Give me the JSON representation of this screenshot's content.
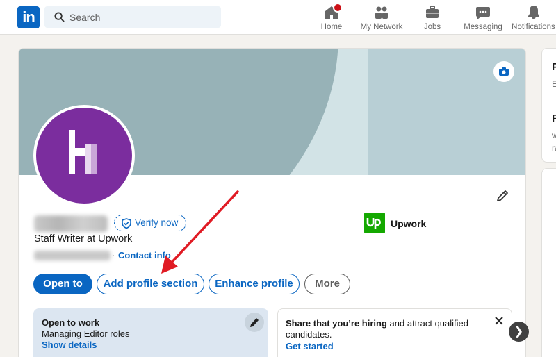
{
  "nav": {
    "logo_text": "in",
    "search_placeholder": "Search",
    "items": [
      {
        "label": "Home",
        "icon": "home-icon"
      },
      {
        "label": "My Network",
        "icon": "people-icon"
      },
      {
        "label": "Jobs",
        "icon": "briefcase-icon"
      },
      {
        "label": "Messaging",
        "icon": "chat-icon"
      },
      {
        "label": "Notifications",
        "icon": "bell-icon"
      }
    ]
  },
  "profile": {
    "verify_label": "Verify now",
    "headline": "Staff Writer at Upwork",
    "location_separator": "·",
    "contact_label": "Contact info",
    "company": {
      "name": "Upwork",
      "logo_text": "up",
      "color": "#14a800"
    },
    "buttons": {
      "open_to": "Open to",
      "add_section": "Add profile section",
      "enhance": "Enhance profile",
      "more": "More"
    }
  },
  "open_to_work": {
    "title": "Open to work",
    "roles": "Managing Editor roles",
    "link": "Show details"
  },
  "hiring": {
    "bold": "Share that you’re hiring",
    "rest": " and attract qualified candidates.",
    "link": "Get started"
  },
  "carousel": {
    "next_glyph": "❯"
  },
  "side": {
    "a": "P",
    "b": "E",
    "c": "P",
    "d": "w",
    "e": "ra"
  },
  "colors": {
    "brand": "#0a66c2",
    "avatar": "#7b2d9e",
    "annotation_arrow": "#e01b24"
  }
}
